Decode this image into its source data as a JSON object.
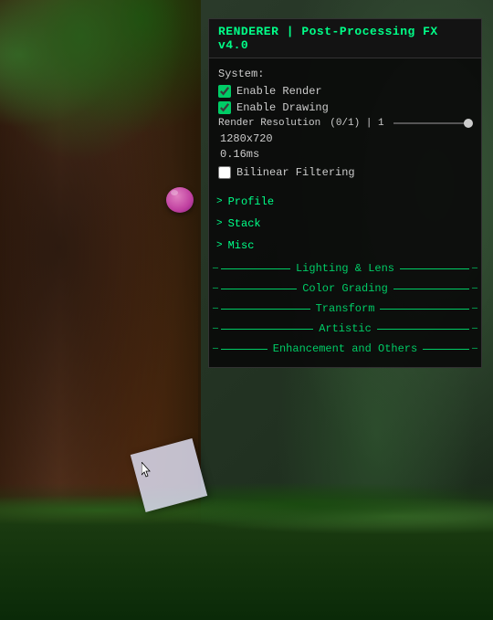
{
  "panel": {
    "title": "RENDERER | Post-Processing FX v4.0",
    "system_label": "System:",
    "enable_render_label": "Enable Render",
    "enable_render_checked": true,
    "enable_drawing_label": "Enable Drawing",
    "enable_drawing_checked": true,
    "render_resolution_label": "Render Resolution",
    "render_resolution_value": "(0/1) | 1",
    "resolution_display": "1280x720",
    "timing_display": "0.16ms",
    "bilinear_label": "Bilinear Filtering",
    "bilinear_checked": false
  },
  "collapsibles": [
    {
      "arrow": ">",
      "label": "Profile"
    },
    {
      "arrow": ">",
      "label": "Stack"
    },
    {
      "arrow": ">",
      "label": "Misc"
    }
  ],
  "dividers": [
    {
      "label": "Lighting & Lens"
    },
    {
      "label": "Color Grading"
    },
    {
      "label": "Transform"
    },
    {
      "label": "Artistic"
    },
    {
      "label": "Enhancement and Others"
    }
  ],
  "colors": {
    "accent": "#00ff88",
    "text": "#cccccc",
    "panel_bg": "rgba(10,10,10,0.92)"
  }
}
